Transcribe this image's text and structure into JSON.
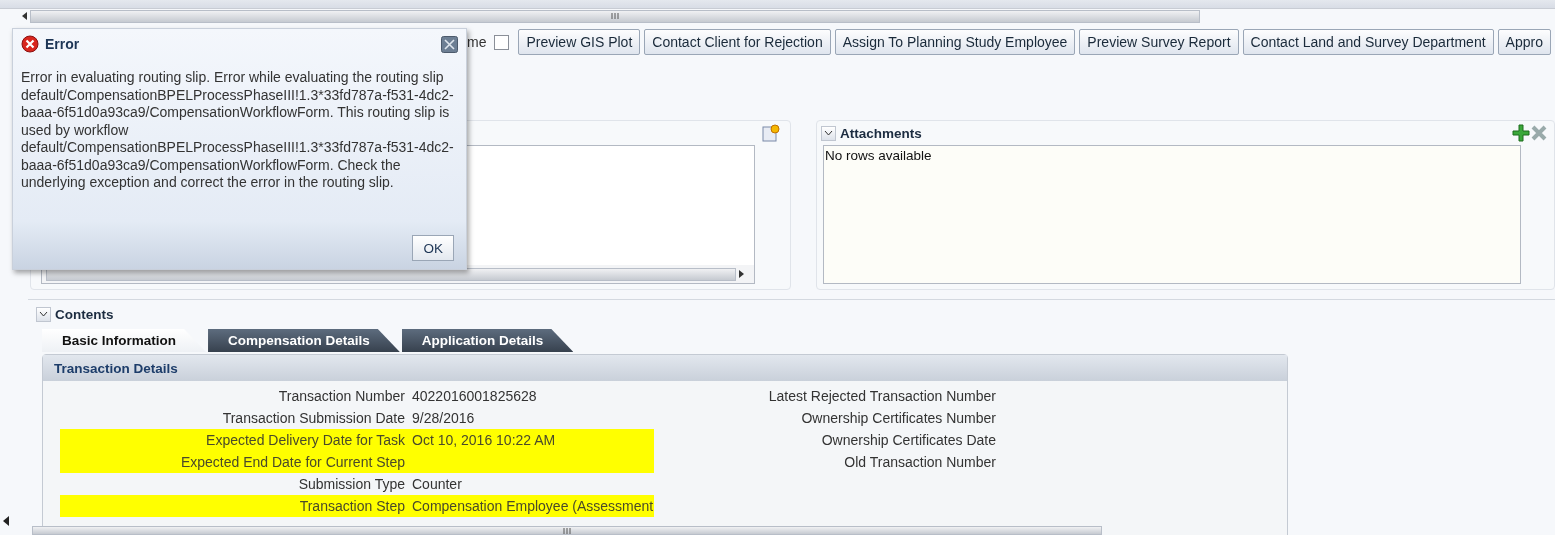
{
  "toolbar": {
    "checkbox": {
      "label": "me",
      "checked": false
    },
    "buttons": [
      "Preview GIS Plot",
      "Contact Client for Rejection",
      "Assign To Planning Study Employee",
      "Preview Survey Report",
      "Contact Land and Survey Department",
      "Appro"
    ]
  },
  "attachments": {
    "title": "Attachments",
    "expanded": true,
    "empty_text": "No rows available"
  },
  "contents": {
    "title": "Contents",
    "expanded": true,
    "tabs": [
      {
        "label": "Basic Information",
        "selected": true
      },
      {
        "label": "Compensation Details",
        "selected": false
      },
      {
        "label": "Application Details",
        "selected": false
      }
    ],
    "section": {
      "title": "Transaction Details",
      "left_fields": [
        {
          "label": "Transaction Number",
          "value": "4022016001825628",
          "highlighted": false
        },
        {
          "label": "Transaction Submission Date",
          "value": "9/28/2016",
          "highlighted": false
        },
        {
          "label": "Expected Delivery Date for Task",
          "value": "Oct 10, 2016 10:22 AM",
          "highlighted": true
        },
        {
          "label": "Expected End Date for Current Step",
          "highlighted": true
        },
        {
          "label": "Submission Type",
          "value": "Counter",
          "highlighted": false
        },
        {
          "label": "Transaction Step",
          "value": "Compensation Employee (Assessment",
          "highlighted": true
        }
      ],
      "right_fields": [
        {
          "label": "Latest Rejected Transaction Number"
        },
        {
          "label": "Ownership Certificates Number"
        },
        {
          "label": "Ownership Certificates Date"
        },
        {
          "label": "Old Transaction Number"
        }
      ]
    }
  },
  "dialog": {
    "title": "Error",
    "message": "Error in evaluating routing slip. Error while evaluating the routing slip default/CompensationBPELProcessPhaseIII!1.3*33fd787a-f531-4dc2-baaa-6f51d0a93ca9/CompensationWorkflowForm. This routing slip is used by workflow default/CompensationBPELProcessPhaseIII!1.3*33fd787a-f531-4dc2-baaa-6f51d0a93ca9/CompensationWorkflowForm. Check the underlying exception and correct the error in the routing slip.",
    "buttons": [
      "OK"
    ]
  }
}
